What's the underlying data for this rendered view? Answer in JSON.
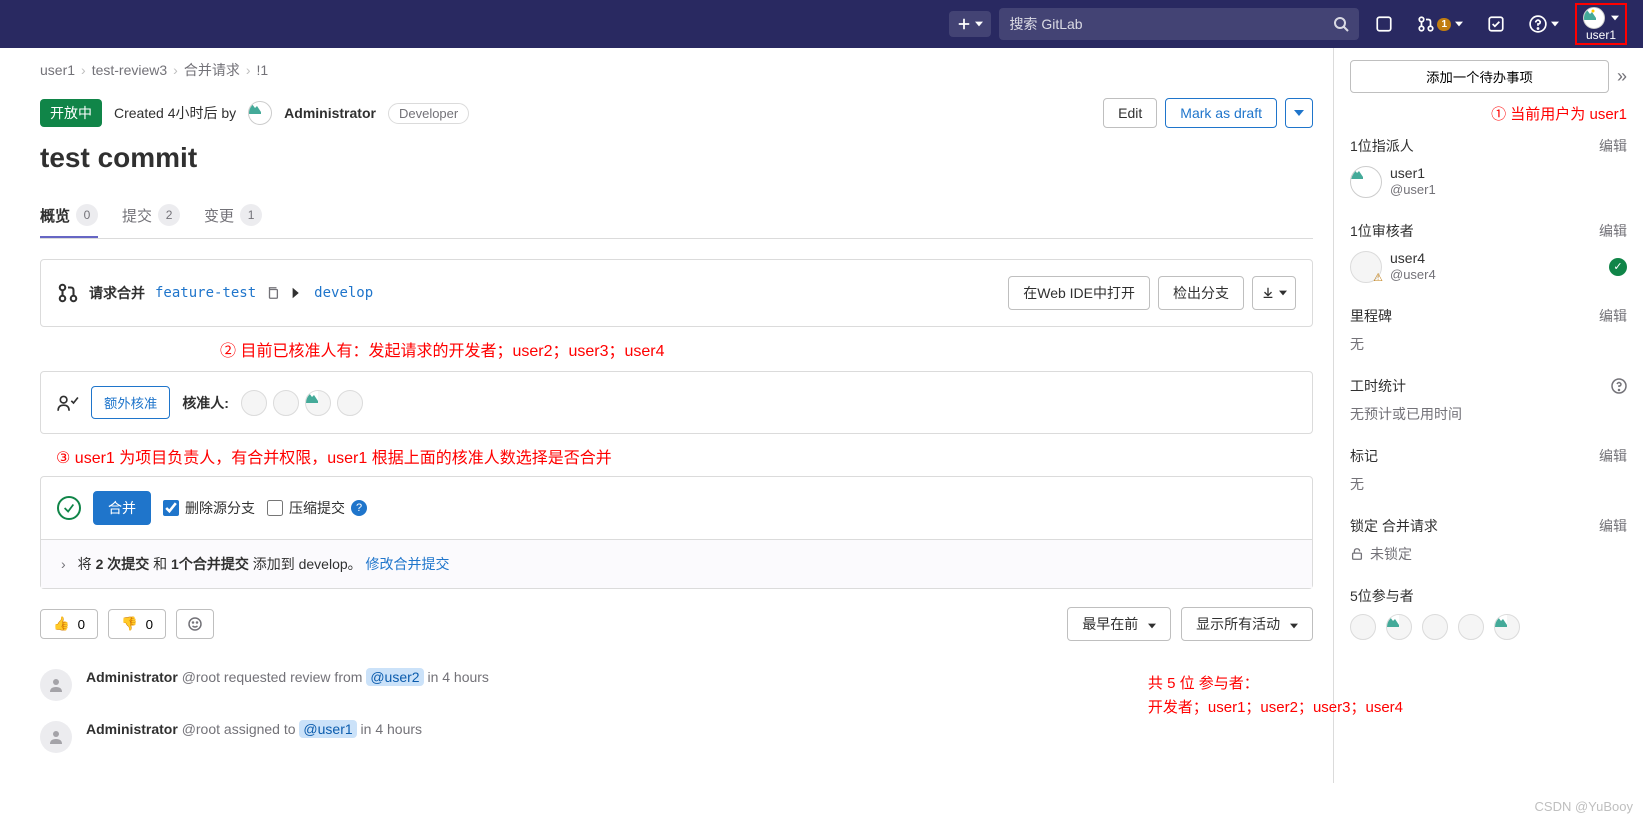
{
  "header": {
    "search_placeholder": "搜索 GitLab",
    "mr_badge": "1",
    "username": "user1"
  },
  "breadcrumb": {
    "items": [
      "user1",
      "test-review3",
      "合并请求",
      "!1"
    ]
  },
  "mr": {
    "status": "开放中",
    "created_prefix": "Created 4小时后 by ",
    "author": "Administrator",
    "role": "Developer",
    "edit_btn": "Edit",
    "draft_btn": "Mark as draft",
    "title": "test commit"
  },
  "tabs": {
    "overview": {
      "label": "概览",
      "count": "0"
    },
    "commits": {
      "label": "提交",
      "count": "2"
    },
    "changes": {
      "label": "变更",
      "count": "1"
    }
  },
  "merge_request_box": {
    "label": "请求合并",
    "source_branch": "feature-test",
    "into": "develop",
    "ide_btn": "在Web IDE中打开",
    "checkout_btn": "检出分支"
  },
  "annotations": {
    "a2": "② 目前已核准人有：发起请求的开发者；user2；user3；user4",
    "a3": "③ user1 为项目负责人，有合并权限，user1 根据上面的核准人数选择是否合并",
    "a1": "① 当前用户为 user1",
    "a4_line1": "共 5 位 参与者：",
    "a4_line2": "开发者；user1；user2；user3；user4"
  },
  "approval": {
    "btn": "额外核准",
    "label": "核准人:"
  },
  "merge": {
    "btn": "合并",
    "delete_branch": "删除源分支",
    "squash": "压缩提交"
  },
  "commits_summary": {
    "prefix": "将 ",
    "bold1": "2 次提交",
    "mid": " 和 ",
    "bold2": "1个合并提交",
    "suffix": " 添加到 develop。 ",
    "link": "修改合并提交"
  },
  "reactions": {
    "up": "0",
    "down": "0",
    "sort_btn": "最早在前",
    "filter_btn": "显示所有活动"
  },
  "activity": [
    {
      "author": "Administrator",
      "handle": "@root",
      "action": " requested review from ",
      "mention": "@user2",
      "time": " in 4 hours"
    },
    {
      "author": "Administrator",
      "handle": "@root",
      "action": " assigned to ",
      "mention": "@user1",
      "time": " in 4 hours"
    }
  ],
  "sidebar": {
    "todo": "添加一个待办事项",
    "assignees": {
      "title": "1位指派人",
      "edit": "编辑",
      "name": "user1",
      "handle": "@user1"
    },
    "reviewers": {
      "title": "1位审核者",
      "edit": "编辑",
      "name": "user4",
      "handle": "@user4"
    },
    "milestone": {
      "title": "里程碑",
      "edit": "编辑",
      "value": "无"
    },
    "time": {
      "title": "工时统计",
      "value": "无预计或已用时间"
    },
    "labels": {
      "title": "标记",
      "edit": "编辑",
      "value": "无"
    },
    "lock": {
      "title": "锁定 合并请求",
      "edit": "编辑",
      "value": "未锁定"
    },
    "participants": {
      "title": "5位参与者"
    }
  },
  "watermark": "CSDN @YuBooy"
}
